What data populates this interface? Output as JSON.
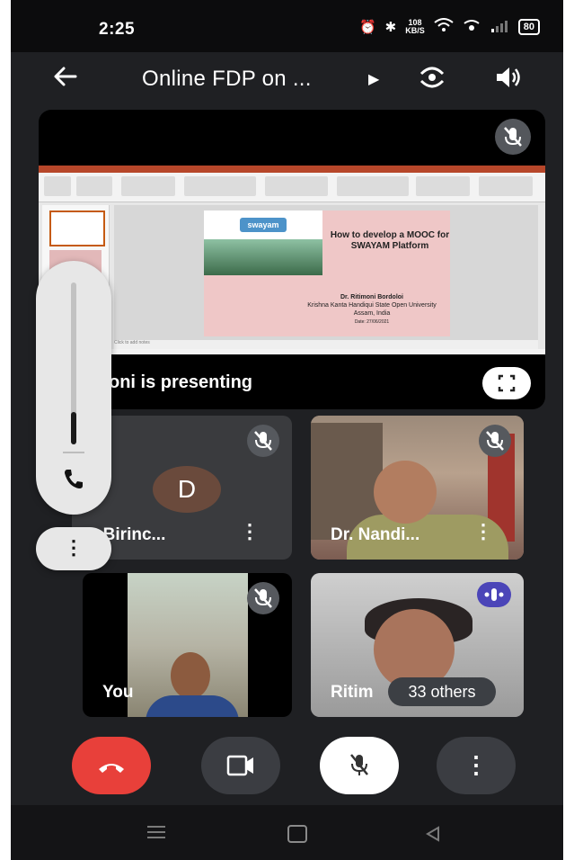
{
  "status_bar": {
    "time": "2:25",
    "net_speed_value": "108",
    "net_speed_unit": "KB/S",
    "battery": "80"
  },
  "top_bar": {
    "title": "Online FDP on ..."
  },
  "presentation": {
    "presenting_label": "oni is presenting",
    "slide": {
      "logo_text": "swayam",
      "heading": "How to develop a MOOC for SWAYAM Platform",
      "author": "Dr. Ritimoni Bordoloi",
      "affiliation": "Krishna Kanta Handiqui State Open University",
      "location": "Assam, India",
      "date": "Date: 27/06/2021",
      "notes_placeholder": "Click to add notes"
    }
  },
  "tiles": [
    {
      "name": "r Birinc...",
      "avatar_letter": "D",
      "muted": true
    },
    {
      "name": "Dr. Nandi...",
      "muted": true
    },
    {
      "name": "You",
      "muted": true
    },
    {
      "name": "Ritim",
      "others": "33 others",
      "speaking": true
    }
  ],
  "colors": {
    "end_call": "#e8403a",
    "speaking_indicator": "#4b45b8",
    "background": "#1f2023"
  },
  "icons": [
    "back-arrow-icon",
    "switch-camera-icon",
    "speaker-icon",
    "mic-off-icon",
    "fullscreen-icon",
    "phone-icon",
    "more-vert-icon",
    "end-call-icon",
    "camera-icon"
  ]
}
